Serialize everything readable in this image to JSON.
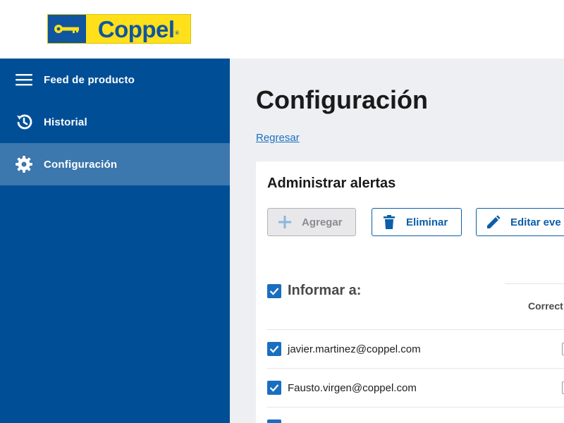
{
  "brand": {
    "name": "Coppel",
    "blue": "#0f55a0",
    "yellow": "#ffe01b"
  },
  "sidebar": {
    "bg": "#004f96",
    "items": [
      {
        "label": "Feed de producto",
        "icon": "menu-icon",
        "active": false
      },
      {
        "label": "Historial",
        "icon": "history-icon",
        "active": false
      },
      {
        "label": "Configuración",
        "icon": "gear-icon",
        "active": true
      }
    ]
  },
  "main": {
    "title": "Configuración",
    "back_link": "Regresar",
    "card": {
      "title": "Administrar alertas",
      "buttons": {
        "add": "Agregar",
        "delete": "Eliminar",
        "edit": "Editar eve"
      },
      "table": {
        "select_all_label": "Informar a:",
        "column_header": "Correct",
        "rows": [
          {
            "email": "javier.martinez@coppel.com",
            "checked": true
          },
          {
            "email": "Fausto.virgen@coppel.com",
            "checked": true
          }
        ]
      }
    }
  }
}
